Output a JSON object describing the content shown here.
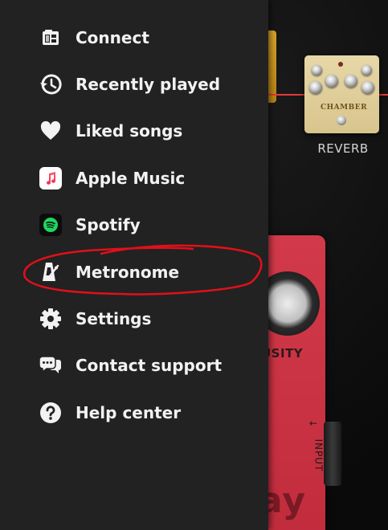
{
  "menu": {
    "items": [
      {
        "label": "Connect",
        "icon": "connect-icon"
      },
      {
        "label": "Recently played",
        "icon": "history-icon"
      },
      {
        "label": "Liked songs",
        "icon": "heart-icon"
      },
      {
        "label": "Apple Music",
        "icon": "apple-music-icon"
      },
      {
        "label": "Spotify",
        "icon": "spotify-icon"
      },
      {
        "label": "Metronome",
        "icon": "metronome-icon"
      },
      {
        "label": "Settings",
        "icon": "gear-icon"
      },
      {
        "label": "Contact support",
        "icon": "chat-bubbles-icon"
      },
      {
        "label": "Help center",
        "icon": "help-icon"
      }
    ],
    "highlighted_item": "Metronome"
  },
  "background": {
    "reverb_pedal": {
      "brand": "CHAMBER",
      "label": "REVERB"
    },
    "red_pedal": {
      "knob_label": "USITY",
      "brand": "ay",
      "input_label": "INPUT"
    }
  },
  "colors": {
    "drawer": "#222222",
    "text": "#f2f2f2",
    "annotation": "#e0101a",
    "cable": "#e33b3b",
    "red_pedal": "#c9303f"
  }
}
